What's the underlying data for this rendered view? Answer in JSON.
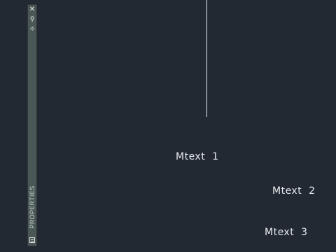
{
  "canvas": {
    "background": "#222933",
    "objects": [
      {
        "type": "mtext",
        "text": "Mtext  1"
      },
      {
        "type": "mtext",
        "text": "Mtext  2"
      },
      {
        "type": "mtext",
        "text": "Mtext  3"
      }
    ]
  },
  "palette": {
    "title": "PROPERTIES",
    "buttons": {
      "close": "close-icon",
      "autohide": "autohide-icon",
      "properties": "properties-icon"
    },
    "colors": {
      "background": "#4a5756",
      "text": "#c9d2d1"
    }
  }
}
